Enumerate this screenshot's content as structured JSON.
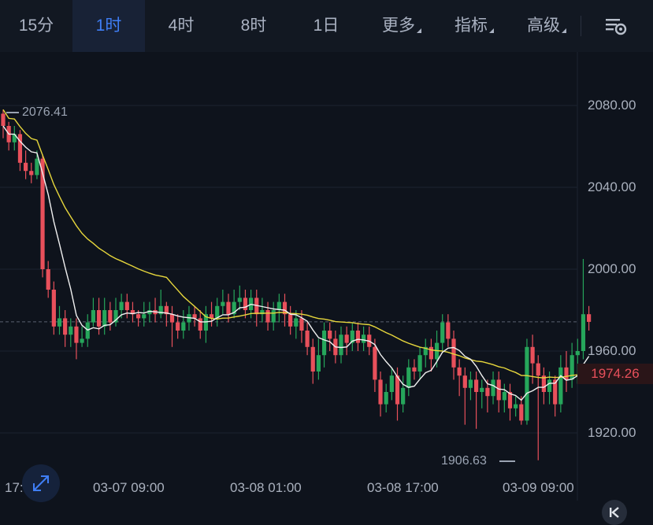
{
  "toolbar": {
    "tabs": [
      {
        "label": "15分",
        "active": false,
        "dropdown": false
      },
      {
        "label": "1时",
        "active": true,
        "dropdown": false
      },
      {
        "label": "4时",
        "active": false,
        "dropdown": false
      },
      {
        "label": "8时",
        "active": false,
        "dropdown": false
      },
      {
        "label": "1日",
        "active": false,
        "dropdown": false
      },
      {
        "label": "更多",
        "active": false,
        "dropdown": true
      },
      {
        "label": "指标",
        "active": false,
        "dropdown": true
      },
      {
        "label": "高级",
        "active": false,
        "dropdown": true
      }
    ],
    "settings_icon": "chart-settings-icon"
  },
  "price_axis": [
    "2080.00",
    "2040.00",
    "2000.00",
    "1960.00",
    "1920.00"
  ],
  "time_axis": [
    "17:00",
    "03-07 09:00",
    "03-08 01:00",
    "03-08 17:00",
    "03-09 09:00"
  ],
  "last_price": "1974.26",
  "high_marker": "2076.41",
  "low_marker": "1906.63",
  "colors": {
    "up": "#26a65b",
    "down": "#e8505b",
    "ma_fast": "#f0f0f0",
    "ma_slow": "#e6d63c",
    "accent": "#3f7ef5"
  },
  "icons": {
    "expand": "expand-arrows-icon",
    "back": "chevron-left-bar-icon"
  },
  "chart_data": {
    "type": "candlestick",
    "ylim": [
      1900,
      2100
    ],
    "candles": [
      [
        2076,
        2070,
        2078,
        2064
      ],
      [
        2070,
        2062,
        2072,
        2058
      ],
      [
        2062,
        2066,
        2070,
        2058
      ],
      [
        2066,
        2052,
        2068,
        2048
      ],
      [
        2052,
        2048,
        2058,
        2044
      ],
      [
        2048,
        2046,
        2052,
        2042
      ],
      [
        2046,
        2054,
        2058,
        2044
      ],
      [
        2054,
        2000,
        2056,
        1996
      ],
      [
        2000,
        1990,
        2004,
        1986
      ],
      [
        1990,
        1972,
        1994,
        1968
      ],
      [
        1972,
        1976,
        1982,
        1968
      ],
      [
        1976,
        1968,
        1980,
        1962
      ],
      [
        1968,
        1972,
        1976,
        1962
      ],
      [
        1972,
        1964,
        1976,
        1956
      ],
      [
        1964,
        1966,
        1972,
        1962
      ],
      [
        1966,
        1974,
        1978,
        1962
      ],
      [
        1974,
        1980,
        1986,
        1972
      ],
      [
        1980,
        1972,
        1986,
        1968
      ],
      [
        1972,
        1980,
        1986,
        1968
      ],
      [
        1980,
        1974,
        1984,
        1970
      ],
      [
        1974,
        1980,
        1986,
        1972
      ],
      [
        1980,
        1984,
        1988,
        1976
      ],
      [
        1984,
        1980,
        1988,
        1976
      ],
      [
        1980,
        1978,
        1984,
        1974
      ],
      [
        1978,
        1976,
        1980,
        1972
      ],
      [
        1976,
        1978,
        1984,
        1972
      ],
      [
        1978,
        1980,
        1984,
        1974
      ],
      [
        1980,
        1978,
        1986,
        1974
      ],
      [
        1978,
        1982,
        1990,
        1976
      ],
      [
        1982,
        1978,
        1984,
        1972
      ],
      [
        1978,
        1974,
        1982,
        1962
      ],
      [
        1974,
        1970,
        1978,
        1966
      ],
      [
        1970,
        1974,
        1980,
        1966
      ],
      [
        1974,
        1978,
        1982,
        1970
      ],
      [
        1978,
        1976,
        1982,
        1972
      ],
      [
        1976,
        1970,
        1980,
        1966
      ],
      [
        1970,
        1978,
        1982,
        1964
      ],
      [
        1978,
        1976,
        1984,
        1972
      ],
      [
        1976,
        1982,
        1986,
        1972
      ],
      [
        1982,
        1984,
        1990,
        1978
      ],
      [
        1984,
        1978,
        1988,
        1974
      ],
      [
        1978,
        1984,
        1990,
        1976
      ],
      [
        1984,
        1986,
        1992,
        1980
      ],
      [
        1986,
        1980,
        1990,
        1976
      ],
      [
        1980,
        1986,
        1990,
        1976
      ],
      [
        1986,
        1978,
        1990,
        1972
      ],
      [
        1978,
        1980,
        1986,
        1974
      ],
      [
        1980,
        1974,
        1984,
        1970
      ],
      [
        1974,
        1980,
        1984,
        1970
      ],
      [
        1980,
        1984,
        1988,
        1974
      ],
      [
        1984,
        1978,
        1988,
        1972
      ],
      [
        1978,
        1972,
        1982,
        1968
      ],
      [
        1972,
        1976,
        1980,
        1966
      ],
      [
        1976,
        1970,
        1980,
        1964
      ],
      [
        1970,
        1962,
        1974,
        1958
      ],
      [
        1962,
        1950,
        1966,
        1944
      ],
      [
        1950,
        1958,
        1966,
        1946
      ],
      [
        1958,
        1970,
        1974,
        1952
      ],
      [
        1970,
        1966,
        1974,
        1960
      ],
      [
        1966,
        1958,
        1970,
        1954
      ],
      [
        1958,
        1968,
        1972,
        1954
      ],
      [
        1968,
        1964,
        1972,
        1958
      ],
      [
        1964,
        1970,
        1974,
        1960
      ],
      [
        1970,
        1964,
        1974,
        1960
      ],
      [
        1964,
        1968,
        1972,
        1960
      ],
      [
        1968,
        1962,
        1972,
        1958
      ],
      [
        1962,
        1946,
        1966,
        1940
      ],
      [
        1946,
        1934,
        1950,
        1928
      ],
      [
        1934,
        1940,
        1944,
        1930
      ],
      [
        1940,
        1948,
        1952,
        1936
      ],
      [
        1948,
        1934,
        1952,
        1926
      ],
      [
        1934,
        1942,
        1948,
        1930
      ],
      [
        1942,
        1952,
        1956,
        1938
      ],
      [
        1952,
        1950,
        1956,
        1946
      ],
      [
        1950,
        1958,
        1962,
        1946
      ],
      [
        1958,
        1962,
        1966,
        1952
      ],
      [
        1962,
        1956,
        1966,
        1950
      ],
      [
        1956,
        1964,
        1970,
        1952
      ],
      [
        1964,
        1974,
        1978,
        1960
      ],
      [
        1974,
        1966,
        1978,
        1962
      ],
      [
        1966,
        1952,
        1970,
        1946
      ],
      [
        1952,
        1948,
        1956,
        1938
      ],
      [
        1948,
        1942,
        1952,
        1924
      ],
      [
        1942,
        1946,
        1950,
        1936
      ],
      [
        1946,
        1940,
        1950,
        1922
      ],
      [
        1940,
        1942,
        1946,
        1932
      ],
      [
        1942,
        1938,
        1946,
        1930
      ],
      [
        1938,
        1946,
        1950,
        1934
      ],
      [
        1946,
        1936,
        1950,
        1930
      ],
      [
        1936,
        1940,
        1944,
        1930
      ],
      [
        1940,
        1932,
        1944,
        1926
      ],
      [
        1932,
        1934,
        1938,
        1928
      ],
      [
        1934,
        1926,
        1938,
        1924
      ],
      [
        1926,
        1962,
        1966,
        1924
      ],
      [
        1962,
        1954,
        1968,
        1944
      ],
      [
        1954,
        1948,
        1958,
        1906.63
      ],
      [
        1948,
        1940,
        1952,
        1934
      ],
      [
        1940,
        1946,
        1950,
        1934
      ],
      [
        1946,
        1934,
        1948,
        1928
      ],
      [
        1934,
        1952,
        1958,
        1930
      ],
      [
        1952,
        1946,
        1960,
        1940
      ],
      [
        1946,
        1958,
        1964,
        1942
      ],
      [
        1958,
        1960,
        1966,
        1944
      ],
      [
        1960,
        1978,
        2005,
        1956
      ],
      [
        1978,
        1974.26,
        1982,
        1970
      ]
    ]
  }
}
